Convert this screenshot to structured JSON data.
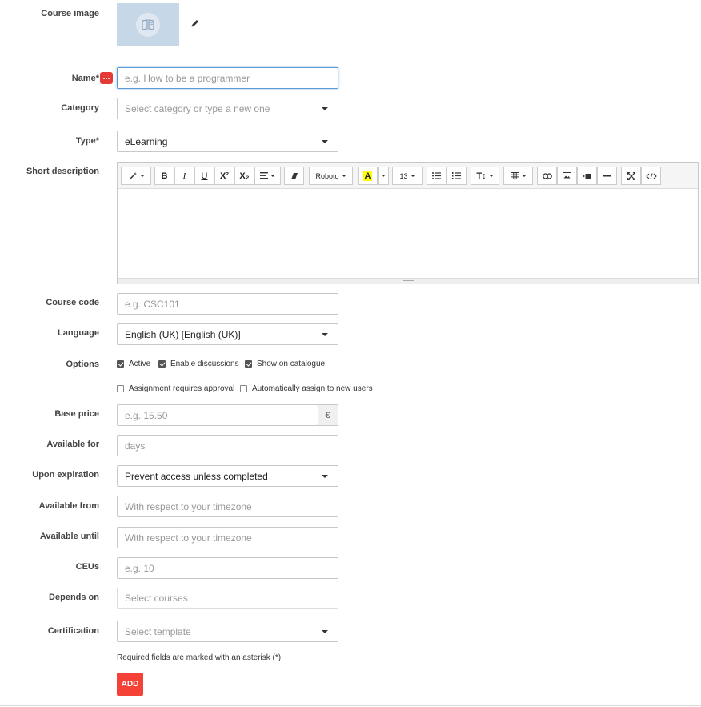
{
  "labels": {
    "course_image": "Course image",
    "name": "Name*",
    "category": "Category",
    "type": "Type*",
    "short_description": "Short description",
    "course_code": "Course code",
    "language": "Language",
    "options": "Options",
    "base_price": "Base price",
    "available_for": "Available for",
    "upon_expiration": "Upon expiration",
    "available_from": "Available from",
    "available_until": "Available until",
    "ceus": "CEUs",
    "depends_on": "Depends on",
    "certification": "Certification"
  },
  "fields": {
    "name": {
      "placeholder": "e.g. How to be a programmer"
    },
    "category": {
      "placeholder": "Select category or type a new one"
    },
    "type": {
      "value": "eLearning"
    },
    "course_code": {
      "placeholder": "e.g. CSC101"
    },
    "language": {
      "value": "English (UK) [English (UK)]"
    },
    "base_price": {
      "placeholder": "e.g. 15.50",
      "currency": "€"
    },
    "available_for": {
      "placeholder": "days"
    },
    "upon_expiration": {
      "value": "Prevent access unless completed"
    },
    "available_from": {
      "placeholder": "With respect to your timezone"
    },
    "available_until": {
      "placeholder": "With respect to your timezone"
    },
    "ceus": {
      "placeholder": "e.g. 10"
    },
    "depends_on": {
      "placeholder": "Select courses"
    },
    "certification": {
      "placeholder": "Select template"
    }
  },
  "options": [
    {
      "label": "Active",
      "checked": true
    },
    {
      "label": "Enable discussions",
      "checked": true
    },
    {
      "label": "Show on catalogue",
      "checked": true
    },
    {
      "label": "Assignment requires approval",
      "checked": false
    },
    {
      "label": "Automatically assign to new users",
      "checked": false
    }
  ],
  "editor": {
    "toolbar": {
      "magic": "magic-wand-icon",
      "bold": "B",
      "italic": "I",
      "underline": "U",
      "superscript": "X²",
      "subscript": "X₂",
      "font": "Roboto",
      "font_color": "A",
      "font_size": "13",
      "line_height": "T↕"
    }
  },
  "note": "Required fields are marked with an asterisk (*).",
  "add_button": "ADD",
  "colors": {
    "accent": "#f44336",
    "focus": "#5b9bd5",
    "highlight": "#ffff00"
  }
}
